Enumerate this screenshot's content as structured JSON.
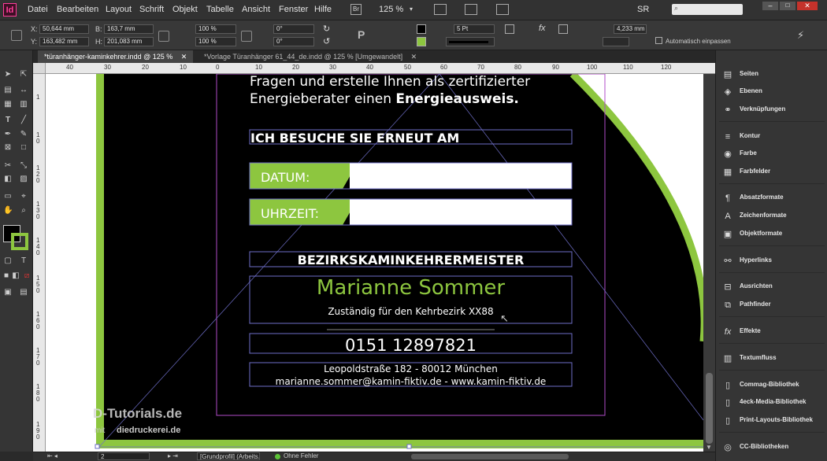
{
  "app": {
    "logo": "Id"
  },
  "menu": [
    "Datei",
    "Bearbeiten",
    "Layout",
    "Schrift",
    "Objekt",
    "Tabelle",
    "Ansicht",
    "Fenster",
    "Hilfe"
  ],
  "menu_right": {
    "br_label": "Br",
    "zoom": "125 %",
    "user": "SR",
    "search_placeholder": ""
  },
  "control": {
    "x_label": "X:",
    "x_value": "50,644 mm",
    "y_label": "Y:",
    "y_value": "163,482 mm",
    "w_label": "B:",
    "w_value": "163,7 mm",
    "h_label": "H:",
    "h_value": "201,083 mm",
    "scale_x": "100 %",
    "scale_y": "100 %",
    "rotate": "0°",
    "shear": "0°",
    "stroke_weight": "5 Pt",
    "ref_value": "4,233 mm",
    "autofit_label": "Automatisch einpassen"
  },
  "tabs": [
    {
      "label": "*türanhänger-kaminkehrer.indd @ 125 %",
      "active": true
    },
    {
      "label": "*Vorlage Türanhänger 61_44_de.indd @ 125 % [Umgewandelt]",
      "active": false
    }
  ],
  "ruler_h": [
    "40",
    "30",
    "20",
    "10",
    "0",
    "10",
    "20",
    "30",
    "40",
    "50",
    "60",
    "70",
    "80",
    "90",
    "100",
    "110",
    "120"
  ],
  "ruler_v": [
    "1",
    "1 0",
    "1 2 0",
    "1 3 0",
    "1 4 0",
    "1 5 0",
    "1 6 0",
    "1 7 0",
    "1 8 0",
    "1 9 0"
  ],
  "document": {
    "intro_line1": "Fragen und erstelle Ihnen als zertifizierter",
    "intro_line2a": "Energieberater einen ",
    "intro_line2b": "Energieausweis.",
    "revisit_heading": "ICH BESUCHE SIE ERNEUT AM",
    "date_label": "DATUM:",
    "time_label": "UHRZEIT:",
    "title_heading": "BEZIRKSKAMINKEHRERMEISTER",
    "name": "Marianne Sommer",
    "district": "Zuständig für den Kehrbezirk XX88",
    "phone": "0151 12897821",
    "address": "Leopoldstraße 182 - 80012 München",
    "email_web": "marianne.sommer@kamin-fiktiv.de - www.kamin-fiktiv.de",
    "watermark_a": "D-Tutorials.de",
    "watermark_b": "mit",
    "watermark_c": "diedruckerei.de"
  },
  "status": {
    "page": "2",
    "profile": "[Grundprofil] (Arbeits...",
    "preflight": "Ohne Fehler"
  },
  "panels": [
    "Seiten",
    "Ebenen",
    "Verknüpfungen",
    "Kontur",
    "Farbe",
    "Farbfelder",
    "Absatzformate",
    "Zeichenformate",
    "Objektformate",
    "Hyperlinks",
    "Ausrichten",
    "Pathfinder",
    "Effekte",
    "Textumfluss",
    "Commag-Bibliothek",
    "4eck-Media-Bibliothek",
    "Print-Layouts-Bibliothek",
    "CC-Bibliotheken"
  ],
  "colors": {
    "accent_green": "#8dc63f",
    "doc_black": "#000000",
    "frame_blue": "#6e6ec8",
    "frame_purple": "#b04dc8"
  }
}
